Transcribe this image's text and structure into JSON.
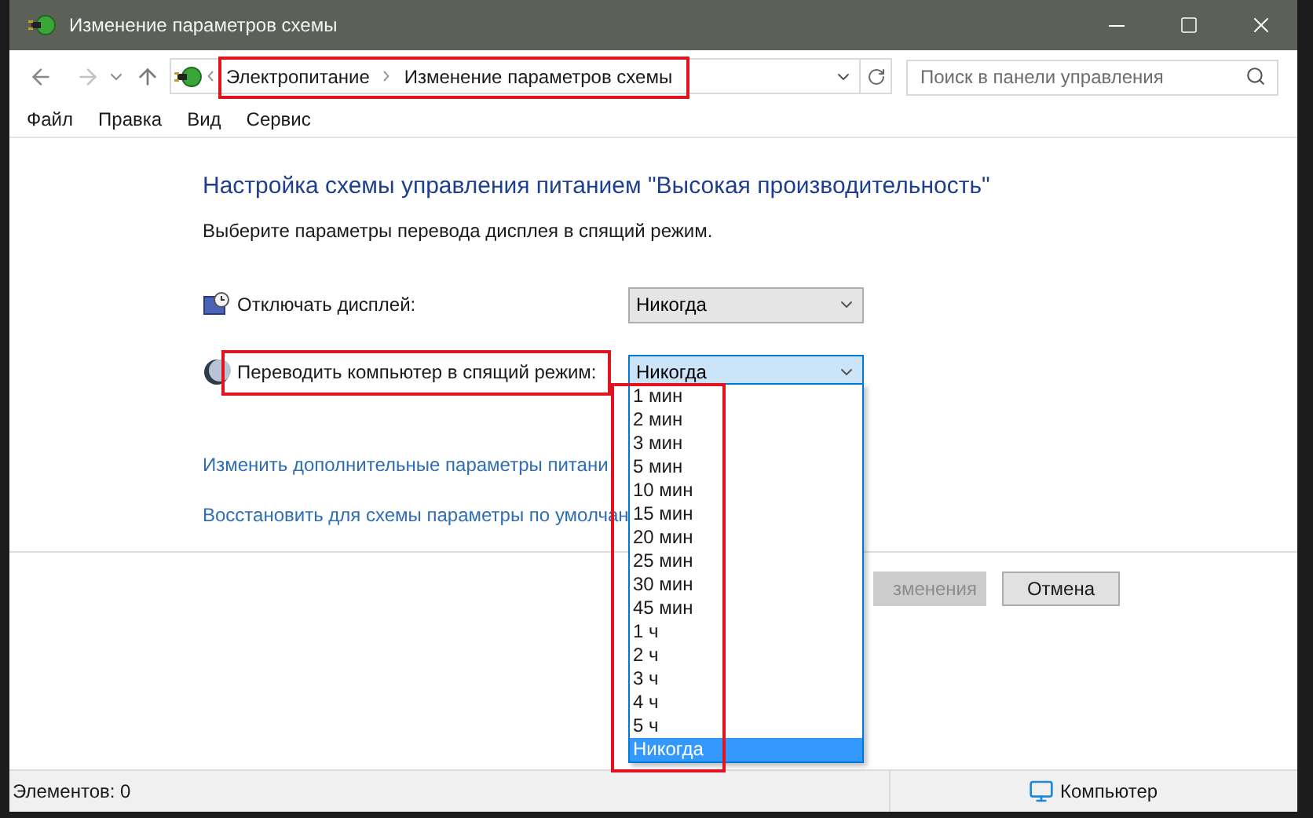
{
  "window": {
    "title": "Изменение параметров схемы"
  },
  "address": {
    "breadcrumbs": [
      "Электропитание",
      "Изменение параметров схемы"
    ]
  },
  "search": {
    "placeholder": "Поиск в панели управления"
  },
  "menu": [
    "Файл",
    "Правка",
    "Вид",
    "Сервис"
  ],
  "heading": "Настройка схемы управления питанием \"Высокая производительность\"",
  "subtitle": "Выберите параметры перевода дисплея в спящий режим.",
  "settings": [
    {
      "kind": "display",
      "label": "Отключать дисплей:",
      "value": "Никогда",
      "expanded": false,
      "highlighted": false
    },
    {
      "kind": "sleep",
      "label": "Переводить компьютер в спящий режим:",
      "value": "Никогда",
      "expanded": true,
      "highlighted": true
    }
  ],
  "options": [
    {
      "label": "1 мин",
      "selected": false
    },
    {
      "label": "2 мин",
      "selected": false
    },
    {
      "label": "3 мин",
      "selected": false
    },
    {
      "label": "5 мин",
      "selected": false
    },
    {
      "label": "10 мин",
      "selected": false
    },
    {
      "label": "15 мин",
      "selected": false
    },
    {
      "label": "20 мин",
      "selected": false
    },
    {
      "label": "25 мин",
      "selected": false
    },
    {
      "label": "30 мин",
      "selected": false
    },
    {
      "label": "45 мин",
      "selected": false
    },
    {
      "label": "1 ч",
      "selected": false
    },
    {
      "label": "2 ч",
      "selected": false
    },
    {
      "label": "3 ч",
      "selected": false
    },
    {
      "label": "4 ч",
      "selected": false
    },
    {
      "label": "5 ч",
      "selected": false
    },
    {
      "label": "Никогда",
      "selected": true
    }
  ],
  "links": [
    "Изменить дополнительные параметры питани",
    "Восстановить для схемы параметры по умолчан"
  ],
  "buttons": [
    {
      "label": "зменения",
      "disabled": true
    },
    {
      "label": "Отмена",
      "disabled": false
    }
  ],
  "status_bar": {
    "items": "Элементов: 0",
    "location": "Компьютер"
  }
}
